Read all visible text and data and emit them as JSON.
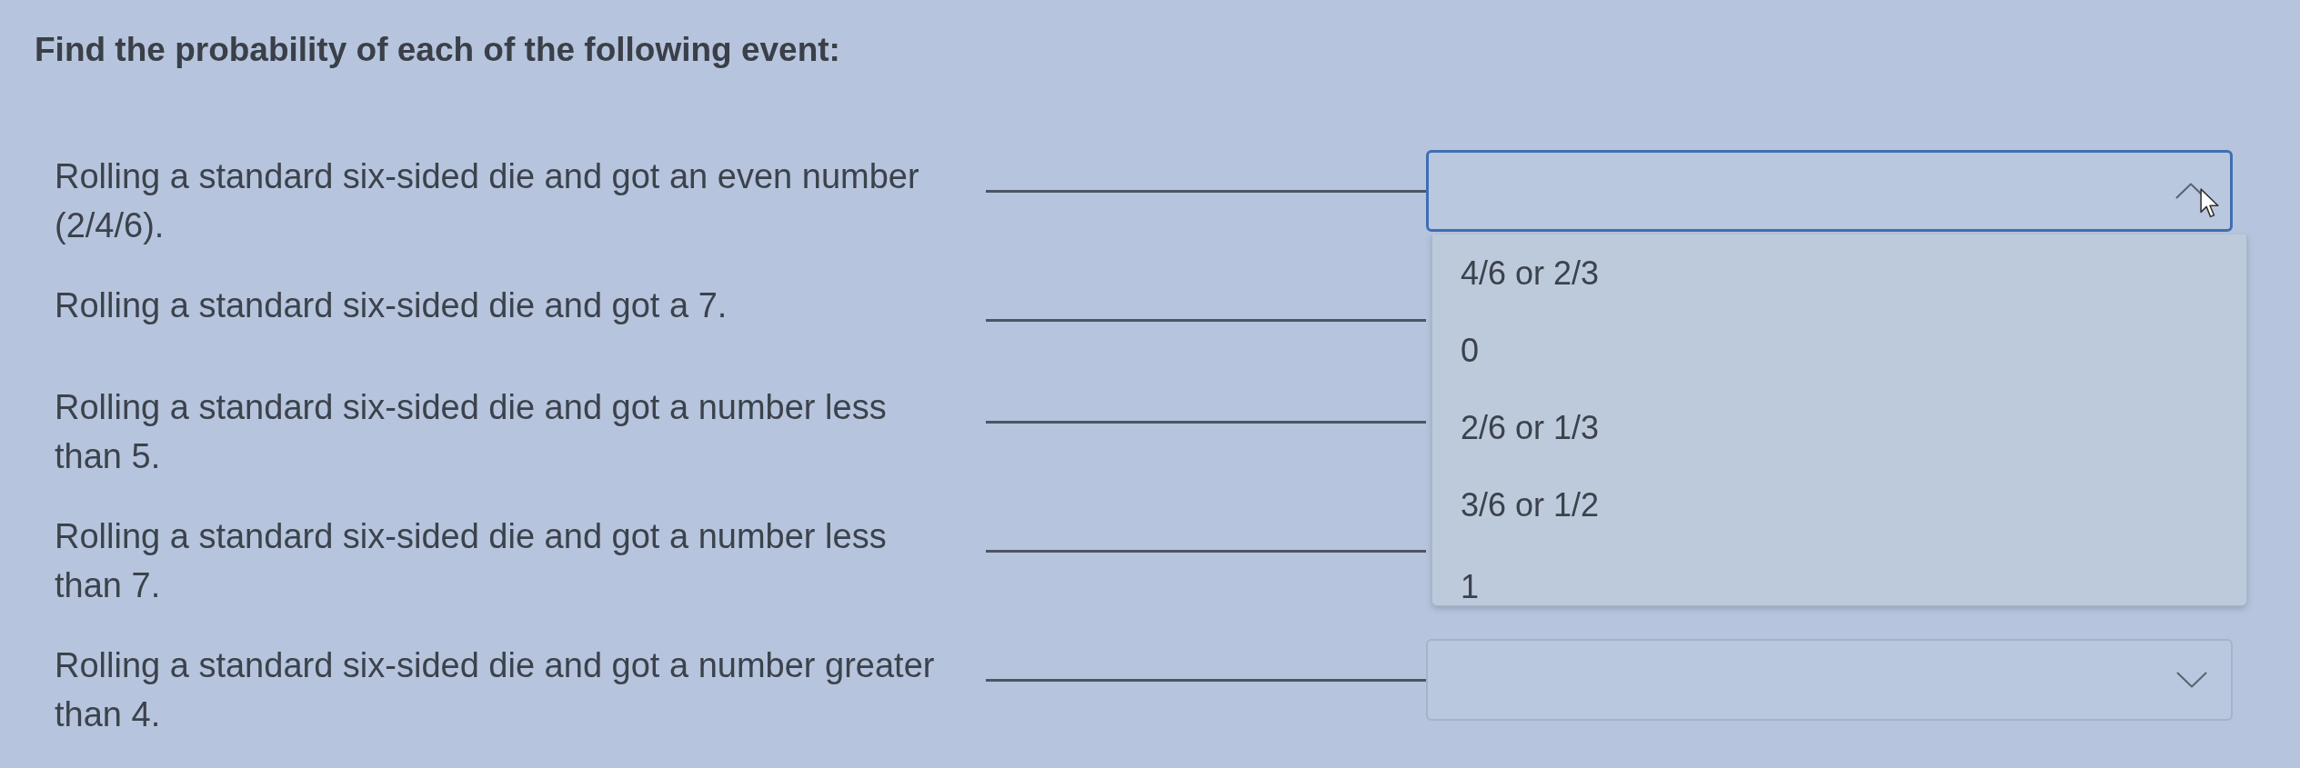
{
  "instruction": "Find the probability of each of the following event:",
  "questions": [
    {
      "text": "Rolling a standard six-sided die and got an even number (2/4/6).",
      "dropdown": {
        "expanded": true,
        "options": [
          {
            "label": "4/6 or 2/3",
            "selected": false
          },
          {
            "label": "0",
            "selected": false
          },
          {
            "label": "2/6 or 1/3",
            "selected": false
          },
          {
            "label": "3/6 or 1/2",
            "selected": false
          },
          {
            "label": "1",
            "selected": false
          }
        ]
      }
    },
    {
      "text": "Rolling a standard six-sided die and got a 7."
    },
    {
      "text": "Rolling a standard six-sided die and got a number less than 5."
    },
    {
      "text": "Rolling a standard six-sided die and got a number less than 7."
    },
    {
      "text": "Rolling a standard six-sided die and got a number greater than 4.",
      "dropdown": {
        "expanded": false
      }
    }
  ]
}
